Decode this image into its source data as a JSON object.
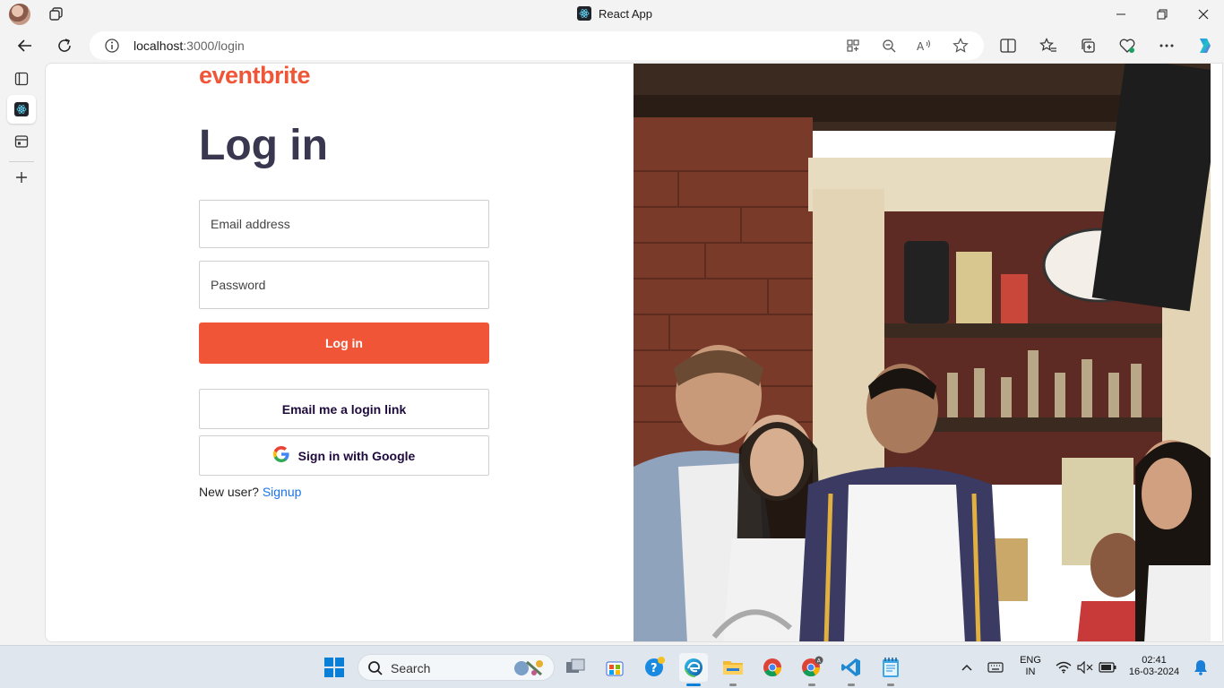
{
  "browser": {
    "window_title": "React App",
    "url_host": "localhost",
    "url_path": ":3000/login"
  },
  "page": {
    "brand": "eventbrite",
    "heading": "Log in",
    "email_placeholder": "Email address",
    "password_placeholder": "Password",
    "login_button": "Log in",
    "email_link_button": "Email me a login link",
    "google_button": "Sign in with Google",
    "new_user_text": "New user?",
    "signup_link": "Signup"
  },
  "taskbar": {
    "search_label": "Search",
    "language_line1": "ENG",
    "language_line2": "IN",
    "time": "02:41",
    "date": "16-03-2024"
  },
  "colors": {
    "brand_orange": "#f05537",
    "heading_navy": "#39364f",
    "link_blue": "#1a73e8"
  }
}
